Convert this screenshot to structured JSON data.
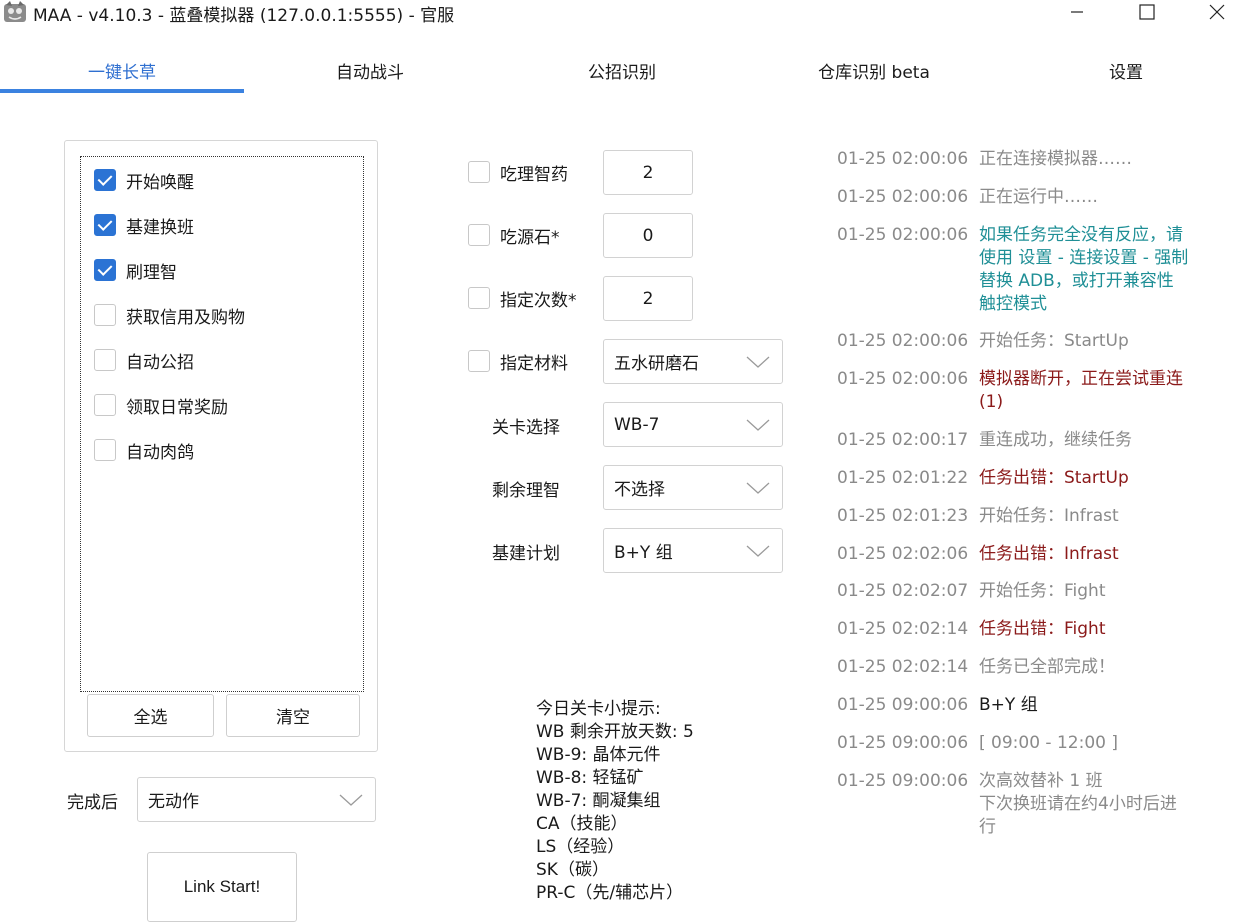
{
  "window": {
    "title": "MAA - v4.10.3 - 蓝叠模拟器 (127.0.0.1:5555) - 官服"
  },
  "tabs": [
    {
      "label": "一键长草",
      "active": true
    },
    {
      "label": "自动战斗",
      "active": false
    },
    {
      "label": "公招识别",
      "active": false
    },
    {
      "label": "仓库识别 beta",
      "active": false
    },
    {
      "label": "设置",
      "active": false
    }
  ],
  "tasks": {
    "items": [
      {
        "label": "开始唤醒",
        "checked": true
      },
      {
        "label": "基建换班",
        "checked": true
      },
      {
        "label": "刷理智",
        "checked": true
      },
      {
        "label": "获取信用及购物",
        "checked": false
      },
      {
        "label": "自动公招",
        "checked": false
      },
      {
        "label": "领取日常奖励",
        "checked": false
      },
      {
        "label": "自动肉鸽",
        "checked": false
      }
    ],
    "select_all_label": "全选",
    "clear_label": "清空"
  },
  "after_complete": {
    "label": "完成后",
    "value": "无动作"
  },
  "link_start_label": "Link Start!",
  "options": {
    "medicine": {
      "label": "吃理智药",
      "value": "2",
      "checked": false
    },
    "stone": {
      "label": "吃源石*",
      "value": "0",
      "checked": false
    },
    "times": {
      "label": "指定次数*",
      "value": "2",
      "checked": false
    },
    "material": {
      "label": "指定材料",
      "value": "五水研磨石",
      "checked": false
    },
    "stage": {
      "label": "关卡选择",
      "value": "WB-7"
    },
    "remaining": {
      "label": "剩余理智",
      "value": "不选择"
    },
    "infrast_plan": {
      "label": "基建计划",
      "value": "B+Y 组"
    }
  },
  "tips": [
    "今日关卡小提示:",
    "WB 剩余开放天数: 5",
    "WB-9: 晶体元件",
    "WB-8: 轻锰矿",
    "WB-7: 酮凝集组",
    "CA（技能）",
    "LS（经验）",
    "SK（碳）",
    "PR-C（先/辅芯片）"
  ],
  "log": [
    {
      "time": "01-25  02:00:06",
      "msg": "正在连接模拟器……",
      "type": "normal"
    },
    {
      "time": "01-25  02:00:06",
      "msg": "正在运行中……",
      "type": "normal"
    },
    {
      "time": "01-25  02:00:06",
      "msg": "如果任务完全没有反应，请使用 设置 - 连接设置 - 强制替换 ADB，或打开兼容性触控模式",
      "type": "info"
    },
    {
      "time": "01-25  02:00:06",
      "msg": "开始任务：StartUp",
      "type": "normal"
    },
    {
      "time": "01-25  02:00:06",
      "msg": "模拟器断开，正在尝试重连(1)",
      "type": "error"
    },
    {
      "time": "01-25  02:00:17",
      "msg": "重连成功，继续任务",
      "type": "normal"
    },
    {
      "time": "01-25  02:01:22",
      "msg": "任务出错：StartUp",
      "type": "error"
    },
    {
      "time": "01-25  02:01:23",
      "msg": "开始任务：Infrast",
      "type": "normal"
    },
    {
      "time": "01-25  02:02:06",
      "msg": "任务出错：Infrast",
      "type": "error"
    },
    {
      "time": "01-25  02:02:07",
      "msg": "开始任务：Fight",
      "type": "normal"
    },
    {
      "time": "01-25  02:02:14",
      "msg": "任务出错：Fight",
      "type": "error"
    },
    {
      "time": "01-25  02:02:14",
      "msg": "任务已全部完成！",
      "type": "normal"
    },
    {
      "time": "01-25  09:00:06",
      "msg": "B+Y 组",
      "type": "dark"
    },
    {
      "time": "01-25  09:00:06",
      "msg": "[ 09:00 - 12:00 ]",
      "type": "normal"
    },
    {
      "time": "01-25  09:00:06",
      "msg": "次高效替补 1 班\n下次换班请在约4小时后进行",
      "type": "normal"
    }
  ],
  "colors": {
    "accent": "#3b82e0",
    "checkbox": "#2b73d4",
    "log_info": "#1f8f96",
    "log_error": "#8b1a1a",
    "log_normal": "#8a8a8a"
  }
}
